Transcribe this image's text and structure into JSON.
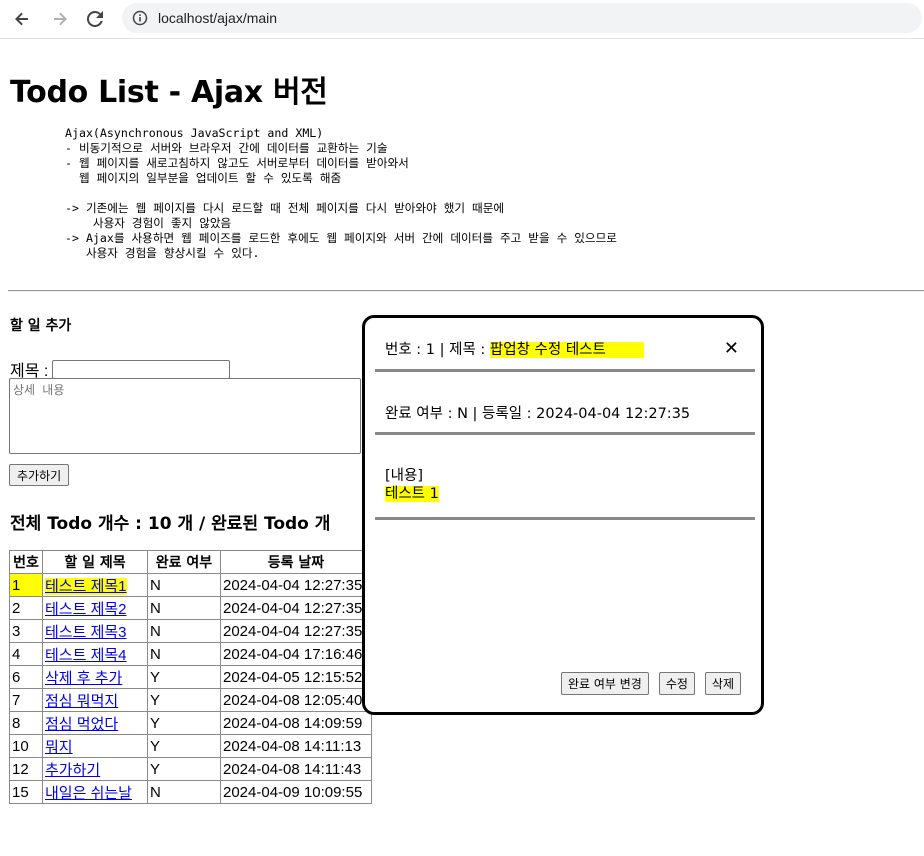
{
  "browser": {
    "url": "localhost/ajax/main"
  },
  "page": {
    "title": "Todo List - Ajax 버전",
    "description": "Ajax(Asynchronous JavaScript and XML)\n- 비동기적으로 서버와 브라우저 간에 데이터를 교환하는 기술\n- 웹 페이지를 새로고침하지 않고도 서버로부터 데이터를 받아와서\n  웹 페이지의 일부분을 업데이트 할 수 있도록 해줌\n\n-> 기존에는 웹 페이지를 다시 로드할 때 전체 페이지를 다시 받아와야 했기 때문에\n    사용자 경험이 좋지 않았음\n-> Ajax를 사용하면 웹 페이즈를 로드한 후에도 웹 페이지와 서버 간에 데이터를 주고 받을 수 있으므로\n   사용자 경험을 향상시킬 수 있다."
  },
  "add_form": {
    "heading": "할 일 추가",
    "title_label": "제목 :",
    "title_value": "",
    "content_placeholder": "상세 내용",
    "submit_label": "추가하기"
  },
  "summary": {
    "text": "전체 Todo 개수 : 10 개 / 완료된 Todo 개"
  },
  "table": {
    "headers": [
      "번호",
      "할 일 제목",
      "완료 여부",
      "등록 날짜"
    ],
    "rows": [
      {
        "no": "1",
        "title": "테스트 제목1",
        "done": "N",
        "date": "2024-04-04 12:27:35"
      },
      {
        "no": "2",
        "title": "테스트 제목2",
        "done": "N",
        "date": "2024-04-04 12:27:35"
      },
      {
        "no": "3",
        "title": "테스트 제목3",
        "done": "N",
        "date": "2024-04-04 12:27:35"
      },
      {
        "no": "4",
        "title": "테스트 제목4",
        "done": "N",
        "date": "2024-04-04 17:16:46"
      },
      {
        "no": "6",
        "title": "삭제 후 추가",
        "done": "Y",
        "date": "2024-04-05 12:15:52"
      },
      {
        "no": "7",
        "title": "점심 뭐먹지",
        "done": "Y",
        "date": "2024-04-08 12:05:40"
      },
      {
        "no": "8",
        "title": "점심 먹었다",
        "done": "Y",
        "date": "2024-04-08 14:09:59"
      },
      {
        "no": "10",
        "title": "뭐지",
        "done": "Y",
        "date": "2024-04-08 14:11:13"
      },
      {
        "no": "12",
        "title": "추가하기",
        "done": "Y",
        "date": "2024-04-08 14:11:43"
      },
      {
        "no": "15",
        "title": "내일은 쉬는날",
        "done": "N",
        "date": "2024-04-09 10:09:55"
      }
    ]
  },
  "popup": {
    "no_label": "번호 : 1 | 제목 : ",
    "title": "팝업창 수정 테스트",
    "close_symbol": "✕",
    "status_line": "완료 여부 : N | 등록일 : 2024-04-04 12:27:35",
    "content_label": "[내용]",
    "content": "테스트 1",
    "buttons": {
      "toggle": "완료 여부 변경",
      "edit": "수정",
      "delete": "삭제"
    }
  },
  "colors": {
    "highlight": "#ffff00",
    "link": "#0000ee"
  }
}
